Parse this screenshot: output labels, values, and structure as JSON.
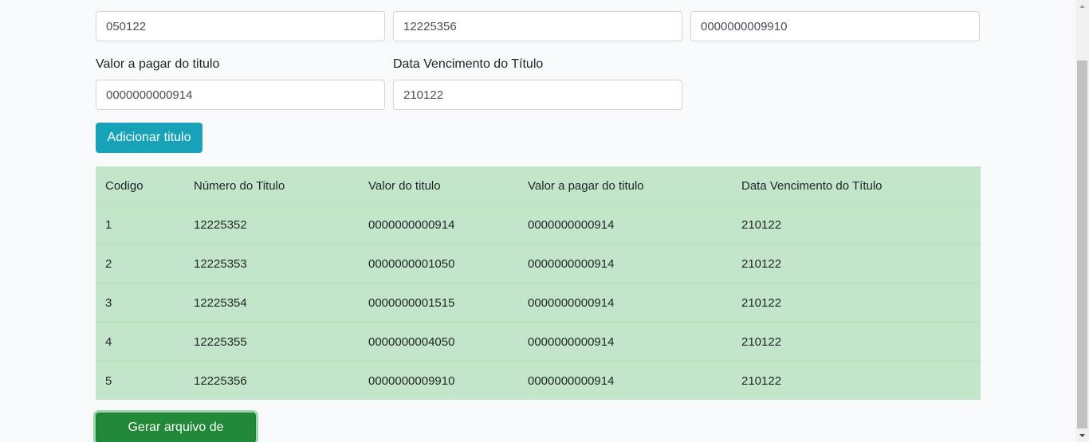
{
  "form": {
    "top_row": {
      "field1_value": "050122",
      "field2_value": "12225356",
      "field3_value": "0000000009910"
    },
    "valor_pagar_label": "Valor a pagar do titulo",
    "valor_pagar_value": "0000000000914",
    "data_venc_label": "Data Vencimento do Título",
    "data_venc_value": "210122",
    "add_button": "Adicionar titulo"
  },
  "table": {
    "headers": [
      "Codigo",
      "Número do Titulo",
      "Valor do titulo",
      "Valor a pagar do titulo",
      "Data Vencimento do Título"
    ],
    "rows": [
      [
        "1",
        "12225352",
        "0000000000914",
        "0000000000914",
        "210122"
      ],
      [
        "2",
        "12225353",
        "0000000001050",
        "0000000000914",
        "210122"
      ],
      [
        "3",
        "12225354",
        "0000000001515",
        "0000000000914",
        "210122"
      ],
      [
        "4",
        "12225355",
        "0000000004050",
        "0000000000914",
        "210122"
      ],
      [
        "5",
        "12225356",
        "0000000009910",
        "0000000000914",
        "210122"
      ]
    ],
    "row_color": "#c3e6cb"
  },
  "generate_button": "Gerar arquivo de retorno",
  "colors": {
    "info": "#17a2b8",
    "success": "#218838",
    "background": "#f8f9fa"
  }
}
